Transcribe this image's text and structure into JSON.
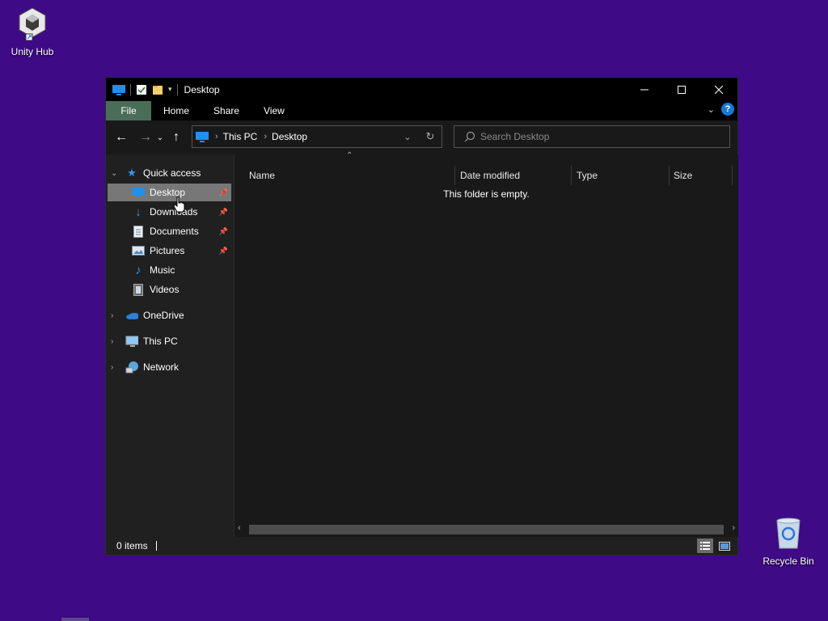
{
  "desktop": {
    "unity_hub_label": "Unity Hub",
    "recycle_bin_label": "Recycle Bin",
    "background_color": "#3e0a86"
  },
  "window": {
    "title": "Desktop",
    "ribbon_tabs": [
      "File",
      "Home",
      "Share",
      "View"
    ],
    "help_label": "?",
    "address": {
      "crumbs": [
        "This PC",
        "Desktop"
      ]
    },
    "search": {
      "placeholder": "Search Desktop"
    },
    "sidebar": {
      "quick_access": "Quick access",
      "items": [
        {
          "label": "Desktop",
          "icon": "desktop-icon",
          "pinned": true,
          "selected": true
        },
        {
          "label": "Downloads",
          "icon": "download-icon",
          "pinned": true
        },
        {
          "label": "Documents",
          "icon": "document-icon",
          "pinned": true
        },
        {
          "label": "Pictures",
          "icon": "picture-icon",
          "pinned": true
        },
        {
          "label": "Music",
          "icon": "music-icon",
          "pinned": false
        },
        {
          "label": "Videos",
          "icon": "video-icon",
          "pinned": false
        }
      ],
      "roots": [
        {
          "label": "OneDrive",
          "icon": "cloud-icon"
        },
        {
          "label": "This PC",
          "icon": "computer-icon"
        },
        {
          "label": "Network",
          "icon": "network-icon"
        }
      ]
    },
    "columns": [
      "Name",
      "Date modified",
      "Type",
      "Size"
    ],
    "empty_message": "This folder is empty.",
    "status": {
      "items_count": "0 items"
    },
    "colors": {
      "file_tab": "#4a6d58",
      "accent": "#1a78d4",
      "selected": "#777777"
    }
  }
}
